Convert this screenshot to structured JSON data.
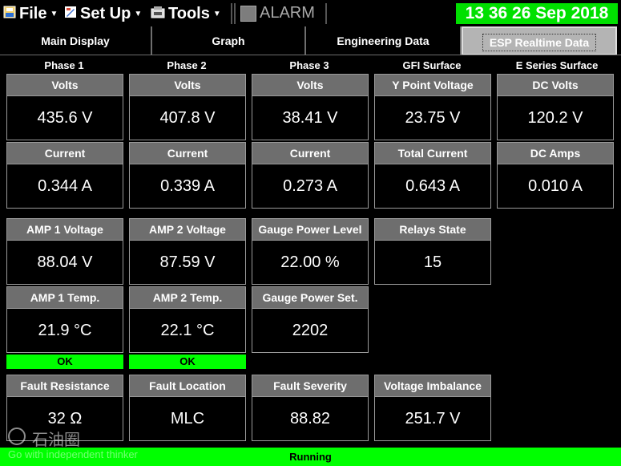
{
  "toolbar": {
    "file_label": "File",
    "setup_label": "Set Up",
    "tools_label": "Tools",
    "alarm_label": "ALARM",
    "clock": "13 36 26 Sep 2018"
  },
  "tabs": [
    {
      "label": "Main Display",
      "active": false
    },
    {
      "label": "Graph",
      "active": false
    },
    {
      "label": "Engineering Data",
      "active": false
    },
    {
      "label": "ESP Realtime Data",
      "active": true
    }
  ],
  "columns": [
    "Phase 1",
    "Phase 2",
    "Phase 3",
    "GFI Surface",
    "E Series Surface"
  ],
  "row1": [
    {
      "label": "Volts",
      "value": "435.6 V"
    },
    {
      "label": "Volts",
      "value": "407.8 V"
    },
    {
      "label": "Volts",
      "value": "38.41 V"
    },
    {
      "label": "Y Point Voltage",
      "value": "23.75 V"
    },
    {
      "label": "DC Volts",
      "value": "120.2 V"
    }
  ],
  "row2": [
    {
      "label": "Current",
      "value": "0.344 A"
    },
    {
      "label": "Current",
      "value": "0.339 A"
    },
    {
      "label": "Current",
      "value": "0.273 A"
    },
    {
      "label": "Total Current",
      "value": "0.643 A"
    },
    {
      "label": "DC Amps",
      "value": "0.010 A"
    }
  ],
  "row3": [
    {
      "label": "AMP 1 Voltage",
      "value": "88.04 V"
    },
    {
      "label": "AMP 2 Voltage",
      "value": "87.59 V"
    },
    {
      "label": "Gauge Power Level",
      "value": "22.00 %"
    },
    {
      "label": "Relays State",
      "value": "15"
    }
  ],
  "row4": [
    {
      "label": "AMP 1 Temp.",
      "value": "21.9 °C",
      "status": "OK"
    },
    {
      "label": "AMP 2 Temp.",
      "value": "22.1 °C",
      "status": "OK"
    },
    {
      "label": "Gauge Power Set.",
      "value": "2202"
    }
  ],
  "row5": [
    {
      "label": "Fault Resistance",
      "value": "32 Ω"
    },
    {
      "label": "Fault Location",
      "value": "MLC"
    },
    {
      "label": "Fault Severity",
      "value": "88.82"
    },
    {
      "label": "Voltage Imbalance",
      "value": "251.7 V"
    }
  ],
  "status_bar": "Running",
  "watermark": {
    "cn": "石油圈",
    "en": "Go with independent thinker"
  },
  "colors": {
    "accent_green": "#00ff00",
    "clock_green": "#00e000",
    "label_bg": "#6e6e6e"
  },
  "icons": {
    "file": "file-icon",
    "setup": "setup-icon",
    "tools": "tools-icon",
    "alarm": "alarm-indicator-icon"
  }
}
